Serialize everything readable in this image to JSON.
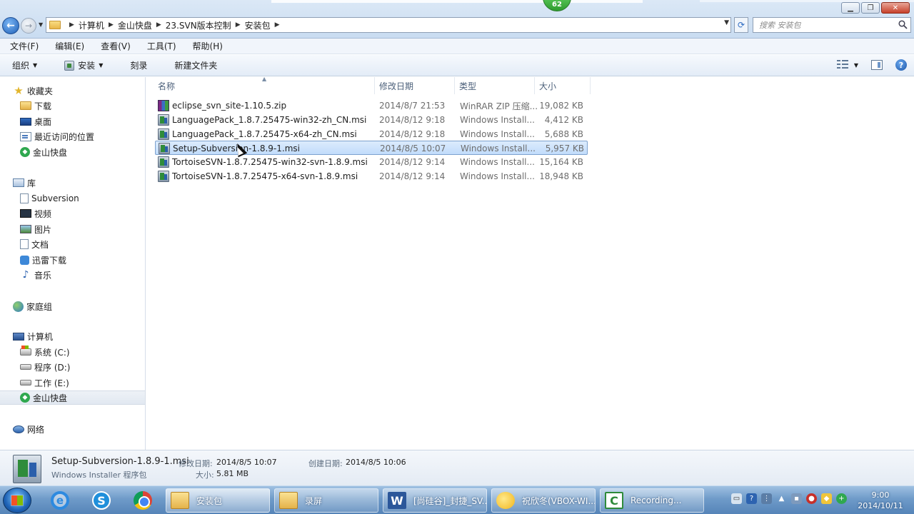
{
  "window": {
    "badge": "62",
    "buttons": {
      "minimize": "▁",
      "maximize": "❐",
      "close": "✕"
    }
  },
  "address": {
    "crumbs": [
      "计算机",
      "金山快盘",
      "23.SVN版本控制",
      "安装包"
    ],
    "search_placeholder": "搜索 安装包"
  },
  "menubar": [
    "文件(F)",
    "编辑(E)",
    "查看(V)",
    "工具(T)",
    "帮助(H)"
  ],
  "commandbar": {
    "organize": "组织",
    "install": "安装",
    "burn": "刻录",
    "new_folder": "新建文件夹"
  },
  "navpane": {
    "favorites": {
      "label": "收藏夹",
      "items": [
        "下载",
        "桌面",
        "最近访问的位置",
        "金山快盘"
      ]
    },
    "libraries": {
      "label": "库",
      "items": [
        "Subversion",
        "视频",
        "图片",
        "文档",
        "迅雷下载",
        "音乐"
      ]
    },
    "homegroup": "家庭组",
    "computer": {
      "label": "计算机",
      "items": [
        "系统 (C:)",
        "程序 (D:)",
        "工作 (E:)",
        "金山快盘"
      ]
    },
    "network": "网络"
  },
  "columns": {
    "name": "名称",
    "modified": "修改日期",
    "type": "类型",
    "size": "大小"
  },
  "files": [
    {
      "name": "eclipse_svn_site-1.10.5.zip",
      "modified": "2014/8/7 21:53",
      "type": "WinRAR ZIP 压缩...",
      "size": "19,082 KB",
      "kind": "zip"
    },
    {
      "name": "LanguagePack_1.8.7.25475-win32-zh_CN.msi",
      "modified": "2014/8/12 9:18",
      "type": "Windows Install...",
      "size": "4,412 KB",
      "kind": "msi"
    },
    {
      "name": "LanguagePack_1.8.7.25475-x64-zh_CN.msi",
      "modified": "2014/8/12 9:18",
      "type": "Windows Install...",
      "size": "5,688 KB",
      "kind": "msi"
    },
    {
      "name": "Setup-Subversion-1.8.9-1.msi",
      "modified": "2014/8/5 10:07",
      "type": "Windows Install...",
      "size": "5,957 KB",
      "kind": "msi",
      "selected": true
    },
    {
      "name": "TortoiseSVN-1.8.7.25475-win32-svn-1.8.9.msi",
      "modified": "2014/8/12 9:14",
      "type": "Windows Install...",
      "size": "15,164 KB",
      "kind": "msi"
    },
    {
      "name": "TortoiseSVN-1.8.7.25475-x64-svn-1.8.9.msi",
      "modified": "2014/8/12 9:14",
      "type": "Windows Install...",
      "size": "18,948 KB",
      "kind": "msi"
    }
  ],
  "details": {
    "name": "Setup-Subversion-1.8.9-1.msi",
    "type": "Windows Installer 程序包",
    "modified_label": "修改日期:",
    "modified": "2014/8/5 10:07",
    "size_label": "大小:",
    "size": "5.81 MB",
    "created_label": "创建日期:",
    "created": "2014/8/5 10:06"
  },
  "taskbar": {
    "tasks": [
      "安装包",
      "录屏",
      "[尚硅谷]_封捷_SV...",
      "祝欣冬(VBOX-WI...",
      "Recording..."
    ],
    "time": "9:00",
    "date": "2014/10/11"
  }
}
